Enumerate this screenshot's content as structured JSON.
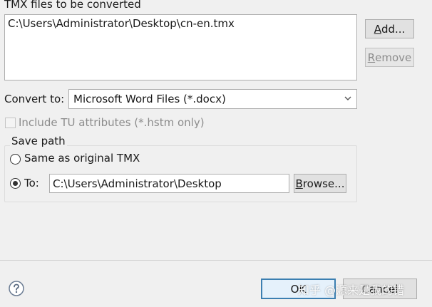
{
  "files": {
    "label": "TMX files to be converted",
    "items": [
      "C:\\Users\\Administrator\\Desktop\\cn-en.tmx"
    ],
    "add_label_pre": "",
    "add_label_key": "A",
    "add_label_post": "dd...",
    "remove_label_pre": "",
    "remove_label_key": "R",
    "remove_label_post": "emove"
  },
  "convert": {
    "label": "Convert to:",
    "selected": "Microsoft Word Files (*.docx)"
  },
  "include_tu": {
    "label": "Include TU attributes (*.hstm only)"
  },
  "save_path": {
    "title": "Save path",
    "same_label": "Same as original TMX",
    "to_label": "To:",
    "to_value": "C:\\Users\\Administrator\\Desktop",
    "browse_pre": "",
    "browse_key": "B",
    "browse_post": "rowse..."
  },
  "footer": {
    "ok_label": "OK",
    "cancel_label": "Cancel",
    "watermark": "知乎 @源来是我的错"
  },
  "colors": {
    "default_button_border": "#3c7fb1",
    "dialog_background": "#f0f0f0"
  }
}
